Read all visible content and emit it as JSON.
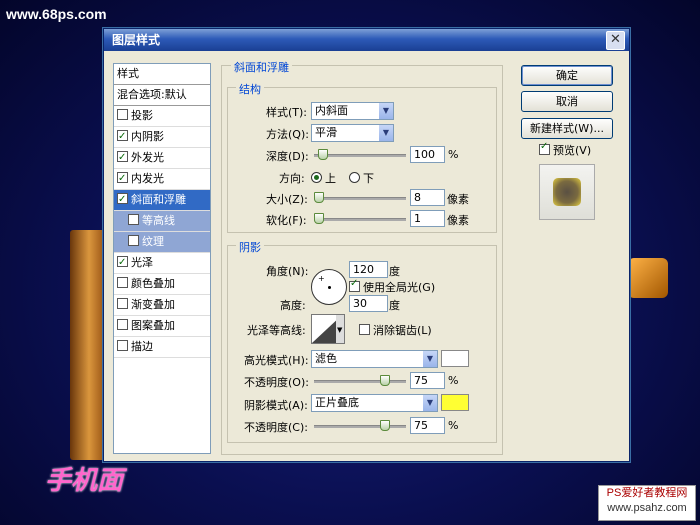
{
  "watermark_top": "www.68ps.com",
  "watermark_bottom": {
    "line1": "PS爱好者教程网",
    "line2": "www.psahz.com"
  },
  "brand_text": "手机面",
  "dialog": {
    "title": "图层样式",
    "close_glyph": "✕"
  },
  "left_panel": {
    "header": "样式",
    "blend_options": "混合选项:默认",
    "items": [
      {
        "label": "投影",
        "checked": false
      },
      {
        "label": "内阴影",
        "checked": true
      },
      {
        "label": "外发光",
        "checked": true
      },
      {
        "label": "内发光",
        "checked": true
      },
      {
        "label": "斜面和浮雕",
        "checked": true
      },
      {
        "label": "等高线",
        "checked": false
      },
      {
        "label": "纹理",
        "checked": false
      },
      {
        "label": "光泽",
        "checked": true
      },
      {
        "label": "颜色叠加",
        "checked": false
      },
      {
        "label": "渐变叠加",
        "checked": false
      },
      {
        "label": "图案叠加",
        "checked": false
      },
      {
        "label": "描边",
        "checked": false
      }
    ]
  },
  "bevel": {
    "group_title": "斜面和浮雕",
    "structure": {
      "title": "结构",
      "style_label": "样式(T):",
      "style_value": "内斜面",
      "technique_label": "方法(Q):",
      "technique_value": "平滑",
      "depth_label": "深度(D):",
      "depth_value": "100",
      "depth_unit": "%",
      "direction_label": "方向:",
      "direction_up": "上",
      "direction_down": "下",
      "size_label": "大小(Z):",
      "size_value": "8",
      "size_unit": "像素",
      "soften_label": "软化(F):",
      "soften_value": "1",
      "soften_unit": "像素"
    },
    "shading": {
      "title": "阴影",
      "angle_label": "角度(N):",
      "angle_value": "120",
      "angle_unit": "度",
      "global_light_label": "使用全局光(G)",
      "altitude_label": "高度:",
      "altitude_value": "30",
      "altitude_unit": "度",
      "gloss_contour_label": "光泽等高线:",
      "antialias_label": "消除锯齿(L)",
      "highlight_mode_label": "高光模式(H):",
      "highlight_mode_value": "滤色",
      "highlight_color": "#ffffff",
      "highlight_opacity_label": "不透明度(O):",
      "highlight_opacity_value": "75",
      "highlight_opacity_unit": "%",
      "shadow_mode_label": "阴影模式(A):",
      "shadow_mode_value": "正片叠底",
      "shadow_color": "#ffff33",
      "shadow_opacity_label": "不透明度(C):",
      "shadow_opacity_value": "75",
      "shadow_opacity_unit": "%"
    }
  },
  "buttons": {
    "ok": "确定",
    "cancel": "取消",
    "new_style": "新建样式(W)...",
    "preview": "预览(V)"
  }
}
